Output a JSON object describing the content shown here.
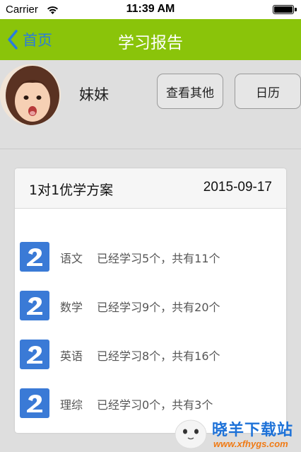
{
  "statusbar": {
    "carrier": "Carrier",
    "time": "11:39 AM"
  },
  "navbar": {
    "back_label": "首页",
    "title": "学习报告"
  },
  "profile": {
    "name": "妹妹",
    "view_others_label": "查看其他",
    "calendar_label": "日历"
  },
  "card": {
    "plan_title": "1对1优学方案",
    "date": "2015-09-17",
    "subjects": [
      {
        "name": "语文",
        "info": "已经学习5个，共有11个"
      },
      {
        "name": "数学",
        "info": "已经学习9个，共有20个"
      },
      {
        "name": "英语",
        "info": "已经学习8个，共有16个"
      },
      {
        "name": "理综",
        "info": "已经学习0个，共有3个"
      }
    ]
  },
  "watermark": {
    "text": "晓羊下载站",
    "url": "www.xfhygs.com"
  },
  "colors": {
    "nav_green": "#8ac40a",
    "accent_blue": "#2a7cdb",
    "badge_blue": "#3a7ad6"
  }
}
